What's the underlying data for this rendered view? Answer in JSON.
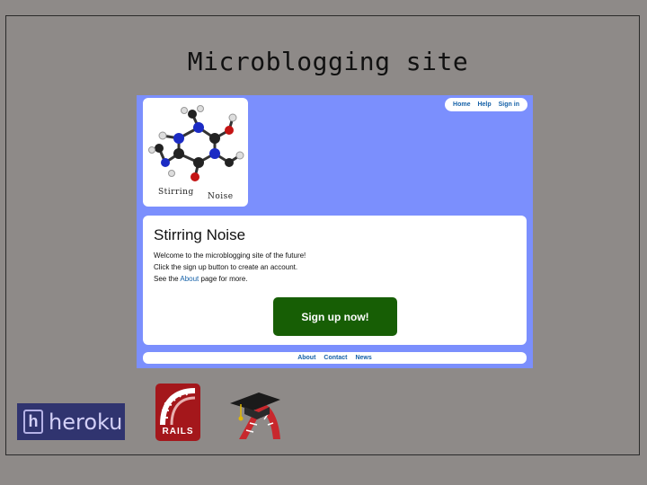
{
  "slide": {
    "title": "Microblogging site"
  },
  "site": {
    "nav": [
      {
        "label": "Home"
      },
      {
        "label": "Help"
      },
      {
        "label": "Sign in"
      }
    ],
    "logo": {
      "line1": "Stirring",
      "line2": "Noise"
    },
    "heading": "Stirring Noise",
    "lines": [
      "Welcome to the microblogging site of the future!",
      "Click the sign up button to create an account."
    ],
    "about_line": {
      "prefix": "See the ",
      "link": "About",
      "suffix": " page for more."
    },
    "signup_label": "Sign up now!",
    "footer": [
      {
        "label": "About"
      },
      {
        "label": "Contact"
      },
      {
        "label": "News"
      }
    ]
  },
  "logos": {
    "heroku": "heroku",
    "rails": "RAILS"
  },
  "colors": {
    "background": "#8e8a88",
    "site_background": "#7b8ffd",
    "signup_button": "#175e05",
    "link": "#1561a8",
    "heroku": "#30346f",
    "rails": "#a4171b"
  }
}
